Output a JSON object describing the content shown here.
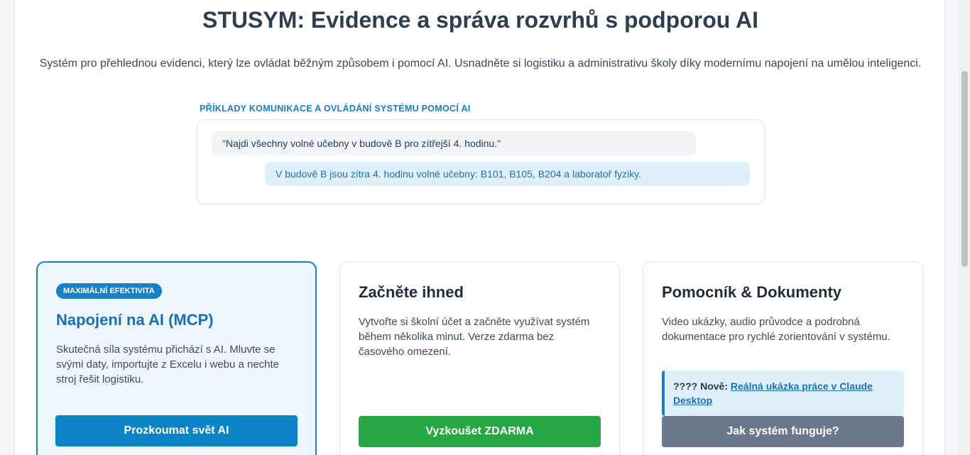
{
  "hero": {
    "title": "STUSYM: Evidence a správa rozvrhů s podporou AI",
    "subtitle": "Systém pro přehlednou evidenci, který lze ovládat běžným způsobem i pomocí AI. Usnadněte si logistiku a administrativu školy díky modernímu napojení na umělou inteligenci."
  },
  "examples": {
    "label": "PŘÍKLADY KOMUNIKACE A OVLÁDÁNÍ SYSTÉMU POMOCÍ AI",
    "user_message": "\"Najdi všechny volné učebny v budově B pro zítřejší 4. hodinu.\"",
    "ai_message": "V budově B jsou zítra 4. hodinu volné učebny: B101, B105, B204 a laboratoř fyziky."
  },
  "cards": [
    {
      "badge": "MAXIMÁLNÍ EFEKTIVITA",
      "title": "Napojení na AI (MCP)",
      "text": "Skutečná síla systému přichází s AI. Mluvte se svými daty, importujte z Excelu i webu a nechte stroj řešit logistiku.",
      "button": "Prozkoumat svět AI"
    },
    {
      "title": "Začněte ihned",
      "text": "Vytvořte si školní účet a začněte využívat systém během několika minut. Verze zdarma bez časového omezení.",
      "button": "Vyzkoušet ZDARMA"
    },
    {
      "title": "Pomocník & Dokumenty",
      "text": "Video ukázky, audio průvodce a podrobná dokumentace pro rychlé zorientování v systému.",
      "notice_prefix": "???? Nově:",
      "notice_link": "Reálná ukázka práce v Claude Desktop",
      "button": "Jak systém funguje?"
    }
  ],
  "colors": {
    "accent_blue": "#1a80c4",
    "green": "#28a745",
    "gray": "#6b778a"
  }
}
